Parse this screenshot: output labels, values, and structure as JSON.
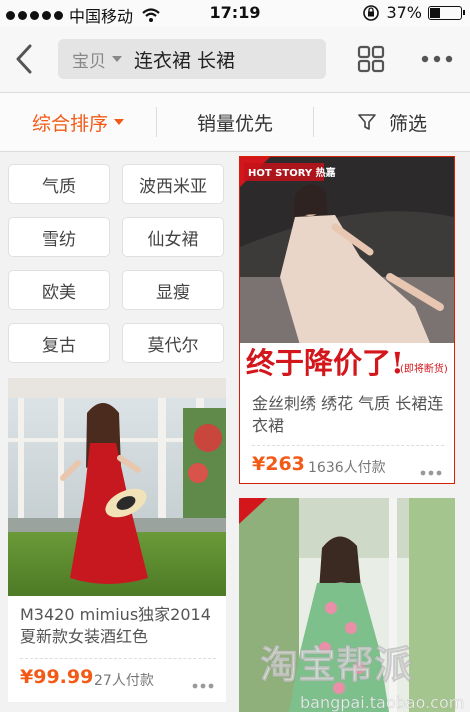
{
  "status_bar": {
    "carrier": "中国移动",
    "time": "17:19",
    "battery_pct_label": "37%",
    "battery_level": 0.37
  },
  "nav": {
    "search_scope": "宝贝",
    "search_query": "连衣裙 长裙"
  },
  "sort": {
    "comprehensive": "综合排序",
    "sales_first": "销量优先",
    "filter": "筛选"
  },
  "tags": [
    "气质",
    "波西米亚",
    "雪纺",
    "仙女裙",
    "欧美",
    "显瘦",
    "复古",
    "莫代尔"
  ],
  "products": [
    {
      "title": "M3420 mimius独家2014夏新款女装酒红色",
      "price": "¥99.99",
      "sold": "27人付款"
    },
    {
      "banner_badge": "HOT STORY 热嘉",
      "banner_text": "终于降价了!",
      "banner_sub": "(即将断货)",
      "title": "金丝刺绣 绣花 气质 长裙连衣裙",
      "price": "¥263",
      "sold": "1636人付款"
    },
    {
      "title": "",
      "price": "",
      "sold": ""
    }
  ],
  "watermark": {
    "brand": "淘宝帮派",
    "url": "bangpai.taobao.com"
  },
  "colors": {
    "accent": "#f25a16",
    "selected_border": "#d81e06"
  }
}
